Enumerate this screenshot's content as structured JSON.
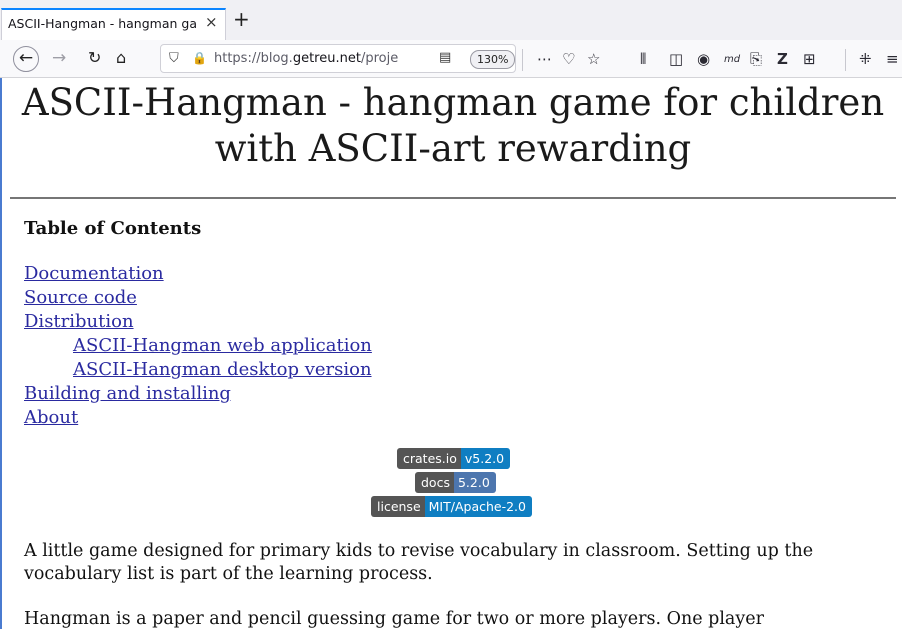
{
  "tab": {
    "title": "ASCII-Hangman - hangman game for children",
    "close": "×",
    "new_tab": "+"
  },
  "nav": {
    "back": "←",
    "forward": "→",
    "reload": "↻",
    "home": "⌂"
  },
  "urlbar": {
    "shield": "⛉",
    "lock": "🔒",
    "url_prefix": "https://blog.",
    "url_domain": "getreu.net",
    "url_path": "/projects/",
    "reader": "▤",
    "zoom": "130%"
  },
  "toolbar": {
    "more": "⋯",
    "pocket": "♡",
    "bookmark": "☆",
    "library": "⫴",
    "sidebar": "◫",
    "account": "◉",
    "md": "md",
    "clip": "⎘",
    "z": "Z",
    "grid": "⊞",
    "ext": "⁜",
    "menu": "≡"
  },
  "page": {
    "title": "ASCII-Hangman - hangman game for children with ASCII-art rewarding",
    "toc_heading": "Table of Contents",
    "toc": [
      {
        "label": "Documentation"
      },
      {
        "label": "Source code"
      },
      {
        "label": "Distribution"
      },
      {
        "label": "ASCII-Hangman web application"
      },
      {
        "label": "ASCII-Hangman desktop version"
      },
      {
        "label": "Building and installing"
      },
      {
        "label": "About"
      }
    ],
    "badges": [
      {
        "left": "crates.io",
        "right": "v5.2.0"
      },
      {
        "left": "docs",
        "right": "5.2.0"
      },
      {
        "left": "license",
        "right": "MIT/Apache-2.0"
      }
    ],
    "paragraph1": "A little game designed for primary kids to revise vocabulary in classroom. Setting up the vocabulary list is part of the learning process.",
    "paragraph2": "Hangman is a paper and pencil guessing game for two or more players. One player"
  }
}
